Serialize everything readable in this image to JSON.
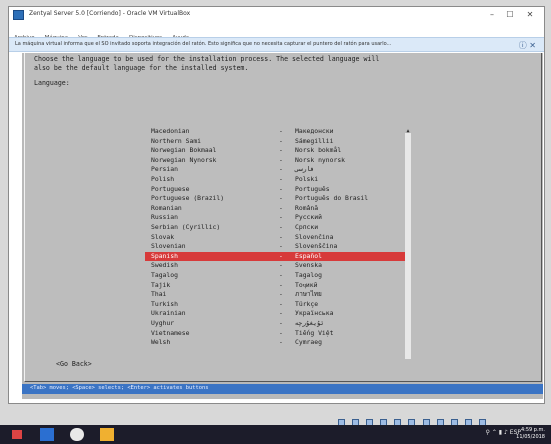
{
  "window": {
    "title": "Zentyal Server 5.0 [Corriendo] - Oracle VM VirtualBox",
    "menus": [
      "Archivo",
      "Máquina",
      "Ver",
      "Entrada",
      "Dispositivos",
      "Ayuda"
    ]
  },
  "notice": {
    "text": "La máquina virtual informa que el SO invitado soporta integración del ratón. Esto significa que no necesita capturar el puntero del ratón para usarlo..."
  },
  "installer": {
    "description": "Choose the language to be used for the installation process. The selected language will\nalso be the default language for the installed system.",
    "language_label": "Language:",
    "languages": [
      {
        "en": "Macedonian",
        "native": "Македонски"
      },
      {
        "en": "Northern Sami",
        "native": "Sámegillii"
      },
      {
        "en": "Norwegian Bokmaal",
        "native": "Norsk bokmål"
      },
      {
        "en": "Norwegian Nynorsk",
        "native": "Norsk nynorsk"
      },
      {
        "en": "Persian",
        "native": "فارسی"
      },
      {
        "en": "Polish",
        "native": "Polski"
      },
      {
        "en": "Portuguese",
        "native": "Português"
      },
      {
        "en": "Portuguese (Brazil)",
        "native": "Português do Brasil"
      },
      {
        "en": "Romanian",
        "native": "Română"
      },
      {
        "en": "Russian",
        "native": "Русский"
      },
      {
        "en": "Serbian (Cyrillic)",
        "native": "Српски"
      },
      {
        "en": "Slovak",
        "native": "Slovenčina"
      },
      {
        "en": "Slovenian",
        "native": "Slovenščina"
      },
      {
        "en": "Spanish",
        "native": "Español"
      },
      {
        "en": "Swedish",
        "native": "Svenska"
      },
      {
        "en": "Tagalog",
        "native": "Tagalog"
      },
      {
        "en": "Tajik",
        "native": "Тоҷикӣ"
      },
      {
        "en": "Thai",
        "native": "ภาษาไทย"
      },
      {
        "en": "Turkish",
        "native": "Türkçe"
      },
      {
        "en": "Ukrainian",
        "native": "Українська"
      },
      {
        "en": "Uyghur",
        "native": "ئۇيغۇرچە"
      },
      {
        "en": "Vietnamese",
        "native": "Tiếng Việt"
      },
      {
        "en": "Welsh",
        "native": "Cymraeg"
      }
    ],
    "selected_index": 13,
    "go_back_label": "<Go Back>",
    "status_line": "<Tab> moves; <Space> selects; <Enter> activates buttons"
  },
  "taskbar": {
    "clock_time": "4:59 p.m.",
    "clock_date": "11/05/2018",
    "tray_lang": "ESP"
  },
  "colors": {
    "selection": "#d73a3a",
    "statusline": "#3b74c4",
    "taskbar": "#1c1c2a"
  }
}
